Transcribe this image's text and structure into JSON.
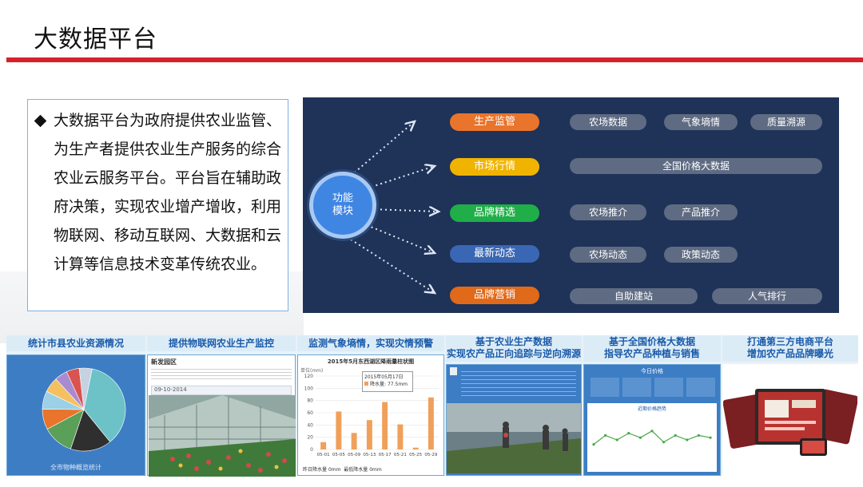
{
  "slide": {
    "title": "大数据平台"
  },
  "intro": {
    "text": "大数据平台为政府提供农业监管、为生产者提供农业生产服务的综合农业云服务平台。平台旨在辅助政府决策，实现农业增产增收，利用物联网、移动互联网、大数据和云计算等信息技术变革传统农业。"
  },
  "diagram": {
    "hub_lines": [
      "功能",
      "模块"
    ],
    "rows": [
      {
        "label": "生产监管",
        "color": "#e9742b",
        "tags": [
          "农场数据",
          "气象墒情",
          "质量溯源"
        ]
      },
      {
        "label": "市场行情",
        "color": "#f0b400",
        "tags": [
          "全国价格大数据"
        ]
      },
      {
        "label": "品牌精选",
        "color": "#1fae48",
        "tags": [
          "农场推介",
          "产品推介"
        ]
      },
      {
        "label": "最新动态",
        "color": "#3a67b3",
        "tags": [
          "农场动态",
          "政策动态"
        ]
      },
      {
        "label": "品牌营销",
        "color": "#e06a1a",
        "tags": [
          "自助建站",
          "人气排行"
        ]
      }
    ]
  },
  "cards": [
    {
      "caption": "统计市县农业资源情况",
      "footer": "全市物种概览统计"
    },
    {
      "caption": "提供物联网农业生产监控",
      "header_text": "新发园区",
      "date_text": "09-10-2014"
    },
    {
      "caption": "监测气象墒情，实现灾情预警",
      "chart_title": "2015年5月东西湖区降雨量柱状图",
      "tooltip_date": "2015年05月17日",
      "tooltip_label": "降水量",
      "tooltip_value": "77.5mm",
      "ylabel": "单位(mm)",
      "footer_left": "昨日降水量",
      "footer_left_val": "0mm",
      "footer_right": "最低降水量",
      "footer_right_val": "0mm"
    },
    {
      "caption_line1": "基于农业生产数据",
      "caption_line2": "实现农产品正向追踪与逆向溯源"
    },
    {
      "caption_line1": "基于全国价格大数据",
      "caption_line2": "指导农产品种植与销售",
      "panel_title": "今日价格",
      "trend_title": "近期价格趋势"
    },
    {
      "caption_line1": "打通第三方电商平台",
      "caption_line2": "增加农产品品牌曝光"
    }
  ],
  "rain_chart": {
    "type": "bar",
    "categories": [
      "05-01",
      "05-05",
      "05-09",
      "05-13",
      "05-17",
      "05-21",
      "05-25",
      "05-29"
    ],
    "values": [
      12,
      62,
      27,
      48,
      77.5,
      41,
      3,
      85
    ],
    "ylim": [
      0,
      120
    ],
    "yticks": [
      0,
      20,
      40,
      60,
      80,
      100,
      120
    ],
    "bar_color": "#f0a05a",
    "title": "2015年5月东西湖区降雨量柱状图"
  },
  "pie_chart": {
    "type": "pie",
    "values": [
      36,
      16,
      12,
      8,
      7,
      6,
      5,
      5,
      5
    ],
    "colors": [
      "#6cc2c7",
      "#2f2f2f",
      "#5aa058",
      "#e9742b",
      "#9bd0e6",
      "#f5c060",
      "#a98bd0",
      "#d9534f",
      "#c7d2e0"
    ]
  },
  "price_trend": {
    "type": "line",
    "values": [
      8,
      12,
      10,
      13,
      11,
      14,
      9,
      12,
      10,
      12,
      11
    ],
    "ylim": [
      0,
      20
    ]
  },
  "colors": {
    "accent_red": "#d4232b",
    "panel_navy": "#1f3258",
    "hub_blue": "#3f86e3"
  }
}
